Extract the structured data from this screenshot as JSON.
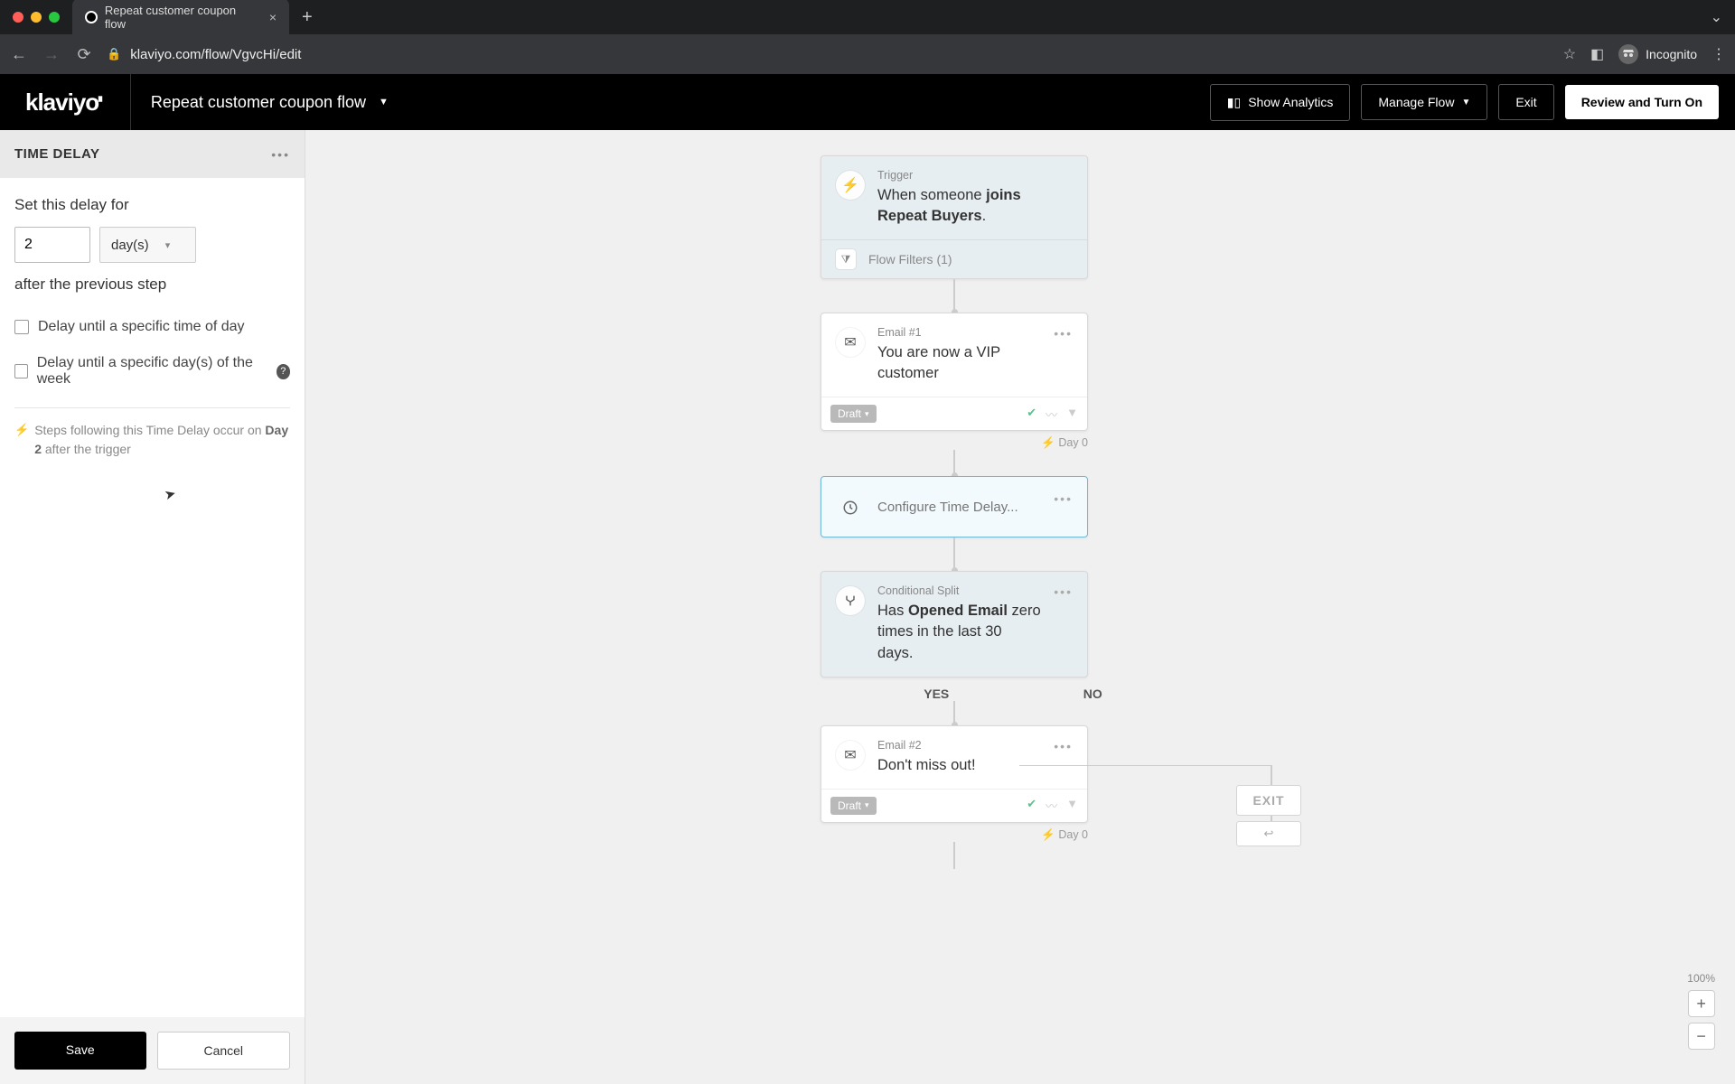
{
  "browser": {
    "tab_title": "Repeat customer coupon flow",
    "url": "klaviyo.com/flow/VgvcHi/edit",
    "incognito_label": "Incognito"
  },
  "header": {
    "logo": "klaviyo",
    "flow_name": "Repeat customer coupon flow",
    "show_analytics": "Show Analytics",
    "manage_flow": "Manage Flow",
    "exit": "Exit",
    "review": "Review and Turn On"
  },
  "sidebar": {
    "title": "TIME DELAY",
    "set_label": "Set this delay for",
    "delay_value": "2",
    "delay_unit": "day(s)",
    "after_text": "after the previous step",
    "opt_time_of_day": "Delay until a specific time of day",
    "opt_day_of_week": "Delay until a specific day(s) of the week",
    "hint_pre": "Steps following this Time Delay occur on ",
    "hint_day": "Day 2",
    "hint_post": " after the trigger",
    "save": "Save",
    "cancel": "Cancel"
  },
  "flow": {
    "trigger": {
      "label": "Trigger",
      "text_pre": "When someone ",
      "text_strong": "joins Repeat Buyers",
      "text_post": ".",
      "filters": "Flow Filters (1)"
    },
    "email1": {
      "label": "Email #1",
      "title": "You are now a VIP customer",
      "status": "Draft",
      "day": "Day 0"
    },
    "delay": {
      "label": "Configure Time Delay..."
    },
    "split": {
      "label": "Conditional Split",
      "text_pre": "Has ",
      "text_strong": "Opened Email",
      "text_post": " zero times in the last 30 days.",
      "yes": "YES",
      "no": "NO"
    },
    "exit_label": "EXIT",
    "email2": {
      "label": "Email #2",
      "title": "Don't miss out!",
      "status": "Draft",
      "day": "Day 0"
    }
  },
  "zoom": {
    "pct": "100%"
  }
}
